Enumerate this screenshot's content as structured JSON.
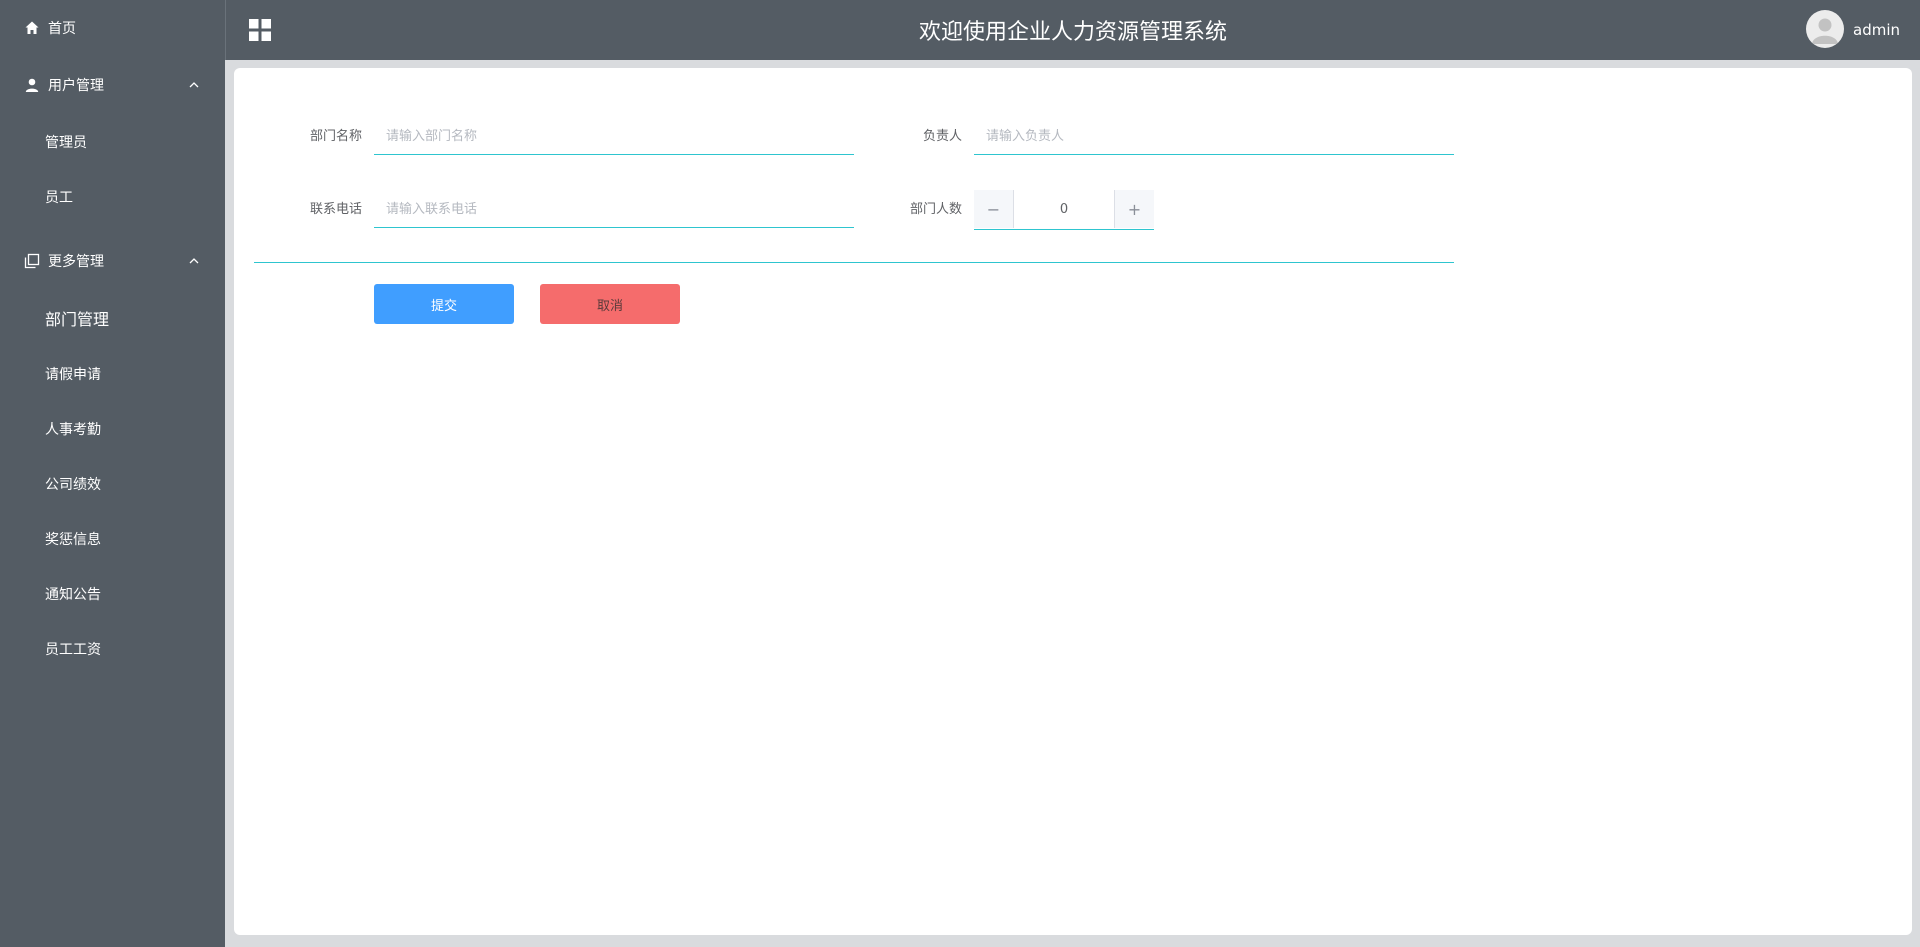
{
  "sidebar": {
    "home": "首页",
    "user_group": "用户管理",
    "user_items": [
      "管理员",
      "员工"
    ],
    "more_group": "更多管理",
    "more_items": [
      "部门管理",
      "请假申请",
      "人事考勤",
      "公司绩效",
      "奖惩信息",
      "通知公告",
      "员工工资"
    ]
  },
  "header": {
    "title": "欢迎使用企业人力资源管理系统",
    "username": "admin"
  },
  "form": {
    "dept_name_label": "部门名称",
    "dept_name_placeholder": "请输入部门名称",
    "leader_label": "负责人",
    "leader_placeholder": "请输入负责人",
    "phone_label": "联系电话",
    "phone_placeholder": "请输入联系电话",
    "count_label": "部门人数",
    "count_value": "0",
    "submit": "提交",
    "cancel": "取消"
  },
  "icons": {
    "home": "home-icon",
    "user": "user-icon",
    "more": "copy-icon",
    "chevron": "chevron-up-icon",
    "grid": "grid-icon",
    "avatar": "avatar-icon",
    "minus": "minus-icon",
    "plus": "plus-icon"
  },
  "colors": {
    "sidebar_bg": "#545c64",
    "accent_line": "#2ec5cf",
    "primary": "#409eff",
    "danger": "#f56c6c"
  }
}
